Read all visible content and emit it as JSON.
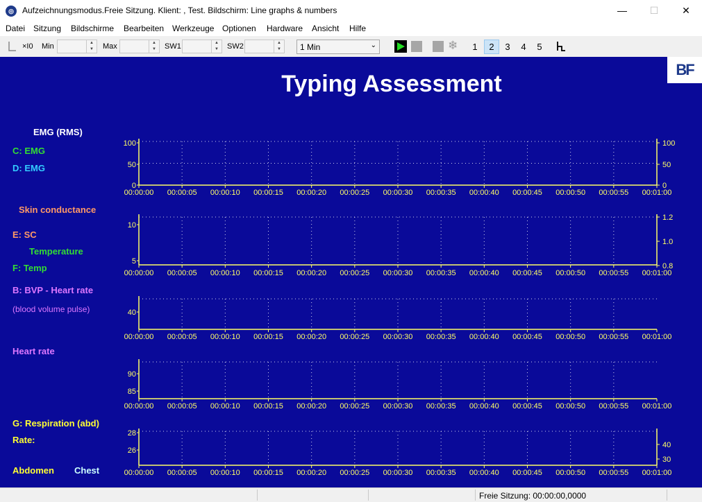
{
  "window": {
    "title": "Aufzeichnungsmodus.Freie Sitzung. Klient: , Test. Bildschirm: Line graphs & numbers",
    "app_icon": "bf-app-icon",
    "controls": {
      "minimize": "—",
      "maximize": "☐",
      "close": "✕"
    }
  },
  "menu": [
    "Datei",
    "Sitzung",
    "Bildschirme",
    "Bearbeiten",
    "Werkzeuge",
    "Optionen",
    "Hardware",
    "Ansicht",
    "Hilfe"
  ],
  "toolbar": {
    "x10_label": "×I0",
    "min_label": "Min",
    "max_label": "Max",
    "sw1_label": "SW1",
    "sw2_label": "SW2",
    "time_range": "1 Min",
    "screens": [
      "1",
      "2",
      "3",
      "4",
      "5"
    ],
    "active_screen": "2"
  },
  "screen": {
    "title": "Typing Assessment",
    "logo_text": "BF",
    "labels": {
      "emg_rms": "EMG (RMS)",
      "c_emg": "C: EMG",
      "d_emg": "D: EMG",
      "skin_conductance": "Skin conductance",
      "e_sc": "E: SC",
      "temperature": "Temperature",
      "f_temp": "F: Temp",
      "b_bvp": "B: BVP - Heart rate",
      "bvp_note": "(blood volume pulse)",
      "heart_rate": "Heart rate",
      "g_resp": "G: Respiration (abd)",
      "rate": "Rate:",
      "abdomen": "Abdomen",
      "chest": "Chest"
    },
    "colors": {
      "background": "#0a0a99",
      "white": "#ffffff",
      "green": "#33dd33",
      "cyan": "#33ccff",
      "salmon": "#ff9966",
      "violet": "#dd77ff",
      "yellow": "#ffff33",
      "axis": "#ffff66"
    }
  },
  "chart_data": [
    {
      "type": "line",
      "name": "emg",
      "x_ticks": [
        "00:00:00",
        "00:00:05",
        "00:00:10",
        "00:00:15",
        "00:00:20",
        "00:00:25",
        "00:00:30",
        "00:00:35",
        "00:00:40",
        "00:00:45",
        "00:00:50",
        "00:00:55",
        "00:01:00"
      ],
      "y_left_ticks": [
        "100",
        "50",
        "0"
      ],
      "y_right_ticks": [
        "100",
        "50",
        "0"
      ],
      "ylim": [
        0,
        100
      ],
      "grid": true,
      "series": []
    },
    {
      "type": "line",
      "name": "sc-temp",
      "x_ticks": [
        "00:00:00",
        "00:00:05",
        "00:00:10",
        "00:00:15",
        "00:00:20",
        "00:00:25",
        "00:00:30",
        "00:00:35",
        "00:00:40",
        "00:00:45",
        "00:00:50",
        "00:00:55",
        "00:01:00"
      ],
      "y_left_ticks": [
        "10",
        "5"
      ],
      "y_right_ticks": [
        "1.2",
        "1.0",
        "0.8"
      ],
      "grid": true,
      "series": []
    },
    {
      "type": "line",
      "name": "bvp",
      "x_ticks": [
        "00:00:00",
        "00:00:05",
        "00:00:10",
        "00:00:15",
        "00:00:20",
        "00:00:25",
        "00:00:30",
        "00:00:35",
        "00:00:40",
        "00:00:45",
        "00:00:50",
        "00:00:55",
        "00:01:00"
      ],
      "y_left_ticks": [
        "40"
      ],
      "y_right_ticks": [],
      "grid": true,
      "series": []
    },
    {
      "type": "line",
      "name": "heart-rate",
      "x_ticks": [
        "00:00:00",
        "00:00:05",
        "00:00:10",
        "00:00:15",
        "00:00:20",
        "00:00:25",
        "00:00:30",
        "00:00:35",
        "00:00:40",
        "00:00:45",
        "00:00:50",
        "00:00:55",
        "00:01:00"
      ],
      "y_left_ticks": [
        "90",
        "85"
      ],
      "y_right_ticks": [],
      "grid": true,
      "series": []
    },
    {
      "type": "line",
      "name": "respiration",
      "x_ticks": [
        "00:00:00",
        "00:00:05",
        "00:00:10",
        "00:00:15",
        "00:00:20",
        "00:00:25",
        "00:00:30",
        "00:00:35",
        "00:00:40",
        "00:00:45",
        "00:00:50",
        "00:00:55",
        "00:01:00"
      ],
      "y_left_ticks": [
        "28",
        "26"
      ],
      "y_right_ticks": [
        "40",
        "30"
      ],
      "grid": true,
      "series": []
    }
  ],
  "status": {
    "session": "Freie Sitzung: 00:00:00,0000"
  }
}
